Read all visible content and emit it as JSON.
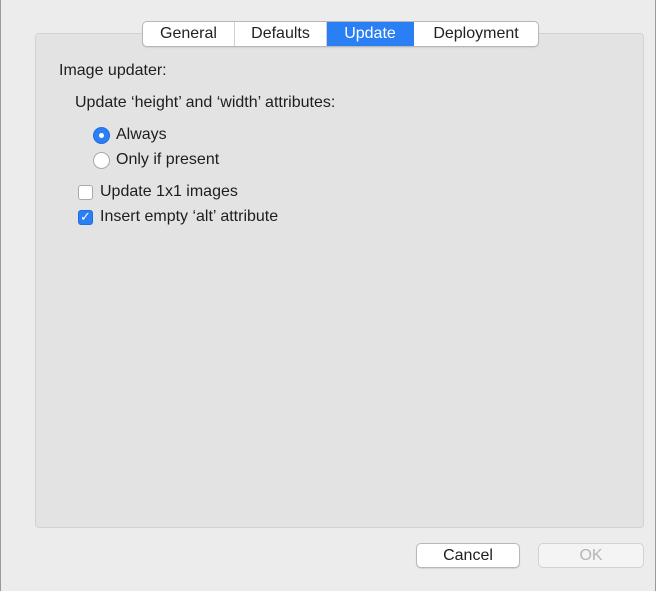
{
  "tabs": [
    {
      "label": "General",
      "selected": false
    },
    {
      "label": "Defaults",
      "selected": false
    },
    {
      "label": "Update",
      "selected": true
    },
    {
      "label": "Deployment",
      "selected": false
    }
  ],
  "section": {
    "title": "Image updater:",
    "subtitle": "Update ‘height’ and ‘width’ attributes:"
  },
  "radios": [
    {
      "label": "Always",
      "selected": true
    },
    {
      "label": "Only if present",
      "selected": false
    }
  ],
  "checkboxes": [
    {
      "label": "Update 1x1 images",
      "checked": false
    },
    {
      "label": "Insert empty ‘alt’ attribute",
      "checked": true
    }
  ],
  "buttons": {
    "cancel": "Cancel",
    "ok": "OK"
  },
  "colors": {
    "accent": "#2b7ff5",
    "panel": "#e3e3e3",
    "window": "#ececec",
    "disabled_text": "#b5b5b5"
  }
}
